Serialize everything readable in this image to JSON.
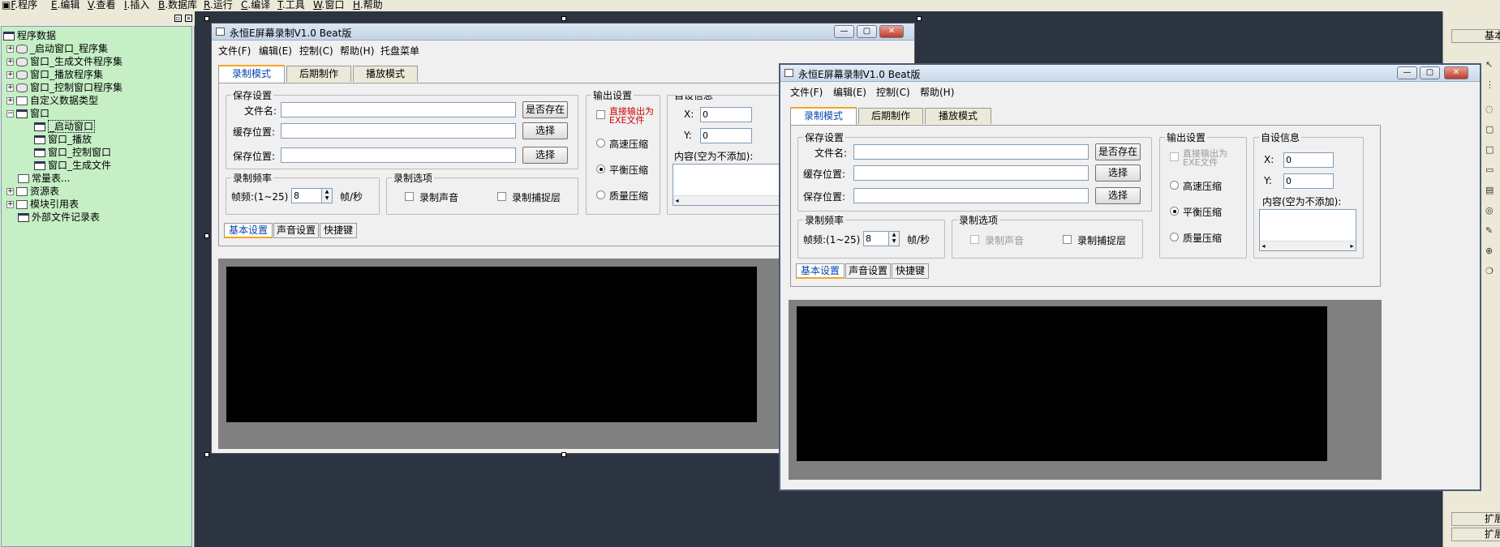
{
  "menubar": [
    {
      "key": "F",
      "label": ".程序"
    },
    {
      "key": "E",
      "label": ".编辑"
    },
    {
      "key": "V",
      "label": ".查看"
    },
    {
      "key": "I",
      "label": ".插入"
    },
    {
      "key": "B",
      "label": ".数据库"
    },
    {
      "key": "R",
      "label": ".运行"
    },
    {
      "key": "C",
      "label": ".编译"
    },
    {
      "key": "T",
      "label": ".工具"
    },
    {
      "key": "W",
      "label": ".窗口"
    },
    {
      "key": "H",
      "label": ".帮助"
    }
  ],
  "tree": {
    "root": "程序数据",
    "items": [
      "_启动窗口_程序集",
      "窗口_生成文件程序集",
      "窗口_播放程序集",
      "窗口_控制窗口程序集",
      "自定义数据类型",
      "窗口",
      "_启动窗口",
      "窗口_播放",
      "窗口_控制窗口",
      "窗口_生成文件",
      "常量表...",
      "资源表",
      "模块引用表",
      "外部文件记录表"
    ]
  },
  "right_panel": {
    "top_button": "基本",
    "bottom_buttons": [
      "扩展",
      "扩展"
    ]
  },
  "app": {
    "title": "永恒E屏幕录制V1.0 Beat版",
    "menu": [
      "文件(F)",
      "编辑(E)",
      "控制(C)",
      "帮助(H)"
    ],
    "tray_menu": "托盘菜单",
    "tabs": [
      "录制模式",
      "后期制作",
      "播放模式"
    ],
    "save_group": "保存设置",
    "filename_label": "文件名:",
    "cache_label": "缓存位置:",
    "save_label": "保存位置:",
    "exists_btn": "是否存在",
    "choose_btn": "选择",
    "output_group": "输出设置",
    "direct_exe": "直接输出为EXE文件",
    "fast": "高速压缩",
    "balanced": "平衡压缩",
    "quality": "质量压缩",
    "custom_group": "自设信息",
    "x_label": "X:",
    "y_label": "Y:",
    "x_value": "0",
    "y_value": "0",
    "content_label": "内容(空为不添加):",
    "freq_group": "录制频率",
    "fps_label": "帧频:(1~25)",
    "fps_value": "8",
    "fps_unit": "帧/秒",
    "opt_group": "录制选项",
    "rec_audio": "录制声音",
    "rec_layer": "录制捕捉层",
    "bottom_tabs": [
      "基本设置",
      "声音设置",
      "快捷键"
    ]
  },
  "colors": {
    "tree_bg": "#c6efc6",
    "accent_tab": "#f5a623",
    "link": "#0645ad"
  }
}
